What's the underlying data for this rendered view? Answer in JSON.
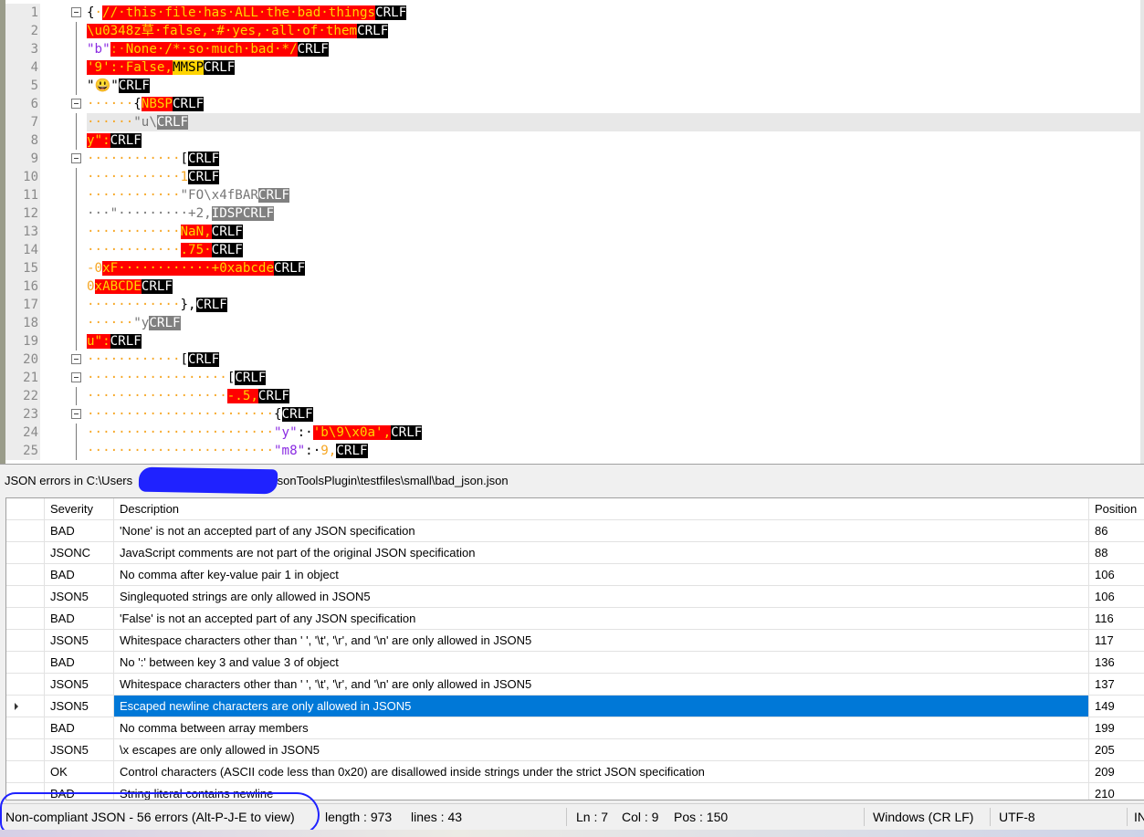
{
  "editor": {
    "lines": [
      {
        "num": "1",
        "fold": "box",
        "segs": [
          [
            "{",
            "#000",
            ""
          ],
          [
            "·",
            "#f6a623",
            ""
          ],
          [
            "//·this·file·has·ALL·the·bad·things",
            "#ffd400",
            "#ff0000"
          ],
          [
            "CR",
            "#fff",
            "#000"
          ],
          [
            "LF",
            "#fff",
            "#000"
          ]
        ]
      },
      {
        "num": "2",
        "fold": "line",
        "segs": [
          [
            "\\u0348z草·false,·#·yes,·all·of·them",
            "#ffd400",
            "#ff0000"
          ],
          [
            "CR",
            "#fff",
            "#000"
          ],
          [
            "LF",
            "#fff",
            "#000"
          ]
        ]
      },
      {
        "num": "3",
        "fold": "line",
        "segs": [
          [
            "\"b\"",
            "#8a2be2",
            ""
          ],
          [
            ":·",
            "#ff9500",
            "#ff0000"
          ],
          [
            "None·/*·so·much·bad·*/",
            "#ffd400",
            "#ff0000"
          ],
          [
            "CR",
            "#fff",
            "#000"
          ],
          [
            "LF",
            "#fff",
            "#000"
          ]
        ]
      },
      {
        "num": "4",
        "fold": "line",
        "segs": [
          [
            "'9':·False,",
            "#ffd400",
            "#ff0000"
          ],
          [
            "MMSP",
            "#000",
            "#ffd400"
          ],
          [
            "CR",
            "#fff",
            "#000"
          ],
          [
            "LF",
            "#fff",
            "#000"
          ]
        ]
      },
      {
        "num": "5",
        "fold": "line",
        "segs": [
          [
            "\"😃\"",
            "#000",
            ""
          ],
          [
            "CR",
            "#fff",
            "#000"
          ],
          [
            "LF",
            "#fff",
            "#000"
          ]
        ]
      },
      {
        "num": "6",
        "fold": "box",
        "segs": [
          [
            "······",
            "#f6a623",
            ""
          ],
          [
            "{",
            "#000",
            ""
          ],
          [
            "NBSP",
            "#ffd400",
            "#ff0000"
          ],
          [
            "CR",
            "#fff",
            "#000"
          ],
          [
            "LF",
            "#fff",
            "#000"
          ]
        ]
      },
      {
        "num": "7",
        "fold": "line",
        "cur": true,
        "segs": [
          [
            "······",
            "#f6a623",
            ""
          ],
          [
            "\"u\\",
            "#777",
            ""
          ],
          [
            "CR",
            "#fff",
            "#808080"
          ],
          [
            "LF",
            "#fff",
            "#808080"
          ]
        ]
      },
      {
        "num": "8",
        "fold": "line",
        "segs": [
          [
            "y\":",
            "#ffd400",
            "#ff0000"
          ],
          [
            "CR",
            "#fff",
            "#000"
          ],
          [
            "LF",
            "#fff",
            "#000"
          ]
        ]
      },
      {
        "num": "9",
        "fold": "box",
        "segs": [
          [
            "············",
            "#f6a623",
            ""
          ],
          [
            "[",
            "#000",
            ""
          ],
          [
            "CR",
            "#fff",
            "#000"
          ],
          [
            "LF",
            "#fff",
            "#000"
          ]
        ]
      },
      {
        "num": "10",
        "fold": "line",
        "segs": [
          [
            "············",
            "#f6a623",
            ""
          ],
          [
            "1",
            "#f6a623",
            ""
          ],
          [
            "CR",
            "#fff",
            "#000"
          ],
          [
            "LF",
            "#fff",
            "#000"
          ]
        ]
      },
      {
        "num": "11",
        "fold": "line",
        "segs": [
          [
            "············",
            "#f6a623",
            ""
          ],
          [
            "\"FO\\x4fBAR",
            "#777",
            ""
          ],
          [
            "CR",
            "#fff",
            "#808080"
          ],
          [
            "LF",
            "#fff",
            "#808080"
          ]
        ]
      },
      {
        "num": "12",
        "fold": "line",
        "segs": [
          [
            "···\"·········",
            "#777",
            ""
          ],
          [
            "+2,",
            "#777",
            ""
          ],
          [
            "IDSP",
            "#fff",
            "#808080"
          ],
          [
            "CR",
            "#fff",
            "#808080"
          ],
          [
            "LF",
            "#fff",
            "#808080"
          ]
        ]
      },
      {
        "num": "13",
        "fold": "line",
        "segs": [
          [
            "············",
            "#f6a623",
            ""
          ],
          [
            "NaN,",
            "#ffd400",
            "#ff0000"
          ],
          [
            "CR",
            "#fff",
            "#000"
          ],
          [
            "LF",
            "#fff",
            "#000"
          ]
        ]
      },
      {
        "num": "14",
        "fold": "line",
        "segs": [
          [
            "············",
            "#f6a623",
            ""
          ],
          [
            ".75·",
            "#ffd400",
            "#ff0000"
          ],
          [
            "CR",
            "#fff",
            "#000"
          ],
          [
            "LF",
            "#fff",
            "#000"
          ]
        ]
      },
      {
        "num": "15",
        "fold": "line",
        "segs": [
          [
            "-0",
            "#f6a623",
            ""
          ],
          [
            "xF············+0xabcde",
            "#ffd400",
            "#ff0000"
          ],
          [
            "CR",
            "#fff",
            "#000"
          ],
          [
            "LF",
            "#fff",
            "#000"
          ]
        ]
      },
      {
        "num": "16",
        "fold": "line",
        "segs": [
          [
            "0",
            "#f6a623",
            ""
          ],
          [
            "xABCDE",
            "#ffd400",
            "#ff0000"
          ],
          [
            "CR",
            "#fff",
            "#000"
          ],
          [
            "LF",
            "#fff",
            "#000"
          ]
        ]
      },
      {
        "num": "17",
        "fold": "line",
        "segs": [
          [
            "············",
            "#f6a623",
            ""
          ],
          [
            "},",
            "#000",
            ""
          ],
          [
            "CR",
            "#fff",
            "#000"
          ],
          [
            "LF",
            "#fff",
            "#000"
          ]
        ]
      },
      {
        "num": "18",
        "fold": "line",
        "segs": [
          [
            "······",
            "#f6a623",
            ""
          ],
          [
            "\"y",
            "#777",
            ""
          ],
          [
            "CR",
            "#fff",
            "#808080"
          ],
          [
            "LF",
            "#fff",
            "#808080"
          ]
        ]
      },
      {
        "num": "19",
        "fold": "line",
        "segs": [
          [
            "u\":",
            "#ffd400",
            "#ff0000"
          ],
          [
            "CR",
            "#fff",
            "#000"
          ],
          [
            "LF",
            "#fff",
            "#000"
          ]
        ]
      },
      {
        "num": "20",
        "fold": "box",
        "segs": [
          [
            "············",
            "#f6a623",
            ""
          ],
          [
            "[",
            "#000",
            ""
          ],
          [
            "CR",
            "#fff",
            "#000"
          ],
          [
            "LF",
            "#fff",
            "#000"
          ]
        ]
      },
      {
        "num": "21",
        "fold": "box",
        "segs": [
          [
            "··················",
            "#f6a623",
            ""
          ],
          [
            "[",
            "#000",
            ""
          ],
          [
            "CR",
            "#fff",
            "#000"
          ],
          [
            "LF",
            "#fff",
            "#000"
          ]
        ]
      },
      {
        "num": "22",
        "fold": "line",
        "segs": [
          [
            "··················",
            "#f6a623",
            ""
          ],
          [
            "-.5,",
            "#ffd400",
            "#ff0000"
          ],
          [
            "CR",
            "#fff",
            "#000"
          ],
          [
            "LF",
            "#fff",
            "#000"
          ]
        ]
      },
      {
        "num": "23",
        "fold": "box",
        "segs": [
          [
            "························",
            "#f6a623",
            ""
          ],
          [
            "{",
            "#000",
            ""
          ],
          [
            "CR",
            "#fff",
            "#000"
          ],
          [
            "LF",
            "#fff",
            "#000"
          ]
        ]
      },
      {
        "num": "24",
        "fold": "line",
        "segs": [
          [
            "························",
            "#f6a623",
            ""
          ],
          [
            "\"y\"",
            "#8a2be2",
            ""
          ],
          [
            ":·",
            "#000",
            ""
          ],
          [
            "'b\\9\\x0a',",
            "#ffd400",
            "#ff0000"
          ],
          [
            "CR",
            "#fff",
            "#000"
          ],
          [
            "LF",
            "#fff",
            "#000"
          ]
        ]
      },
      {
        "num": "25",
        "fold": "line",
        "segs": [
          [
            "························",
            "#f6a623",
            ""
          ],
          [
            "\"m8\"",
            "#8a2be2",
            ""
          ],
          [
            ":·",
            "#000",
            ""
          ],
          [
            "9,",
            "#f6a623",
            ""
          ],
          [
            "CR",
            "#fff",
            "#000"
          ],
          [
            "LF",
            "#fff",
            "#000"
          ]
        ]
      }
    ]
  },
  "panel": {
    "title_prefix": "JSON errors in C:\\Users",
    "title_suffix": "JsonToolsPlugin\\testfiles\\small\\bad_json.json",
    "columns": {
      "severity": "Severity",
      "description": "Description",
      "position": "Position"
    },
    "rows": [
      {
        "severity": "BAD",
        "description": "'None' is not an accepted part of any JSON specification",
        "position": "86"
      },
      {
        "severity": "JSONC",
        "description": "JavaScript comments are not part of the original JSON specification",
        "position": "88"
      },
      {
        "severity": "BAD",
        "description": "No comma after key-value pair 1 in object",
        "position": "106"
      },
      {
        "severity": "JSON5",
        "description": "Singlequoted strings are only allowed in JSON5",
        "position": "106"
      },
      {
        "severity": "BAD",
        "description": "'False' is not an accepted part of any JSON specification",
        "position": "116"
      },
      {
        "severity": "JSON5",
        "description": "Whitespace characters other than ' ', '\\t', '\\r', and '\\n' are only allowed in JSON5",
        "position": "117"
      },
      {
        "severity": "BAD",
        "description": "No ':' between key 3 and value 3 of object",
        "position": "136"
      },
      {
        "severity": "JSON5",
        "description": "Whitespace characters other than ' ', '\\t', '\\r', and '\\n' are only allowed in JSON5",
        "position": "137"
      },
      {
        "severity": "JSON5",
        "description": "Escaped newline characters are only allowed in JSON5",
        "position": "149",
        "selected": true
      },
      {
        "severity": "BAD",
        "description": "No comma between array members",
        "position": "199"
      },
      {
        "severity": "JSON5",
        "description": "\\x escapes are only allowed in JSON5",
        "position": "205"
      },
      {
        "severity": "OK",
        "description": "Control characters (ASCII code less than 0x20) are disallowed inside strings under the strict JSON specification",
        "position": "209"
      },
      {
        "severity": "BAD",
        "description": "String literal contains newline",
        "position": "210"
      }
    ]
  },
  "status": {
    "errors": "Non-compliant JSON - 56 errors (Alt-P-J-E to view)",
    "length": "length : 973",
    "lines": "lines : 43",
    "ln": "Ln : 7",
    "col": "Col : 9",
    "pos": "Pos : 150",
    "eol": "Windows (CR LF)",
    "encoding": "UTF-8",
    "mode": "IN"
  }
}
